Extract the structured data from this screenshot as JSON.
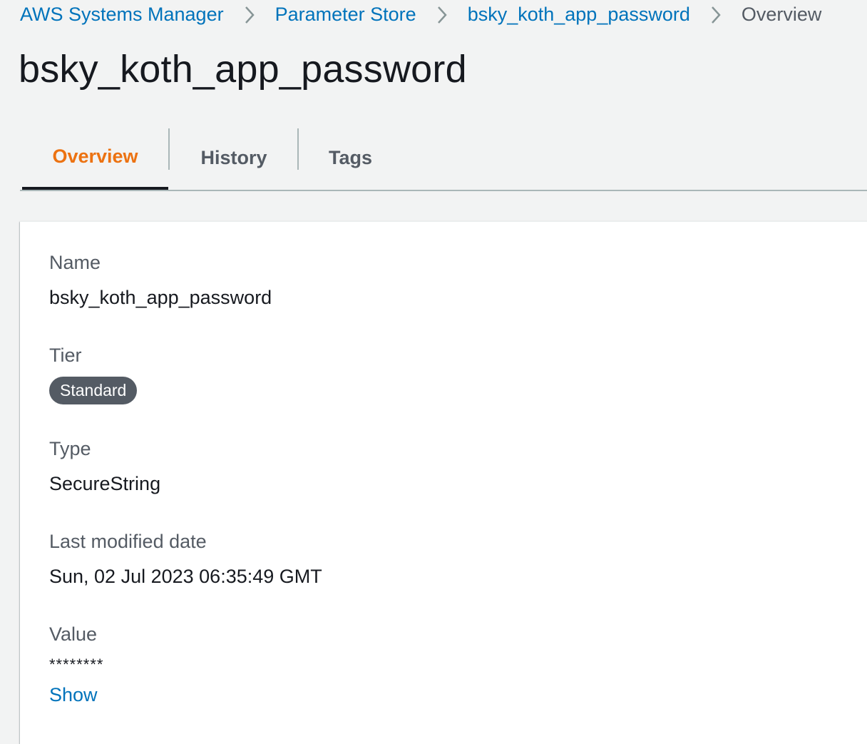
{
  "breadcrumb": {
    "items": [
      {
        "label": "AWS Systems Manager"
      },
      {
        "label": "Parameter Store"
      },
      {
        "label": "bsky_koth_app_password"
      },
      {
        "label": "Overview"
      }
    ]
  },
  "page": {
    "title": "bsky_koth_app_password"
  },
  "tabs": [
    {
      "label": "Overview",
      "active": true
    },
    {
      "label": "History",
      "active": false
    },
    {
      "label": "Tags",
      "active": false
    }
  ],
  "details": {
    "name": {
      "label": "Name",
      "value": "bsky_koth_app_password"
    },
    "tier": {
      "label": "Tier",
      "value": "Standard"
    },
    "type": {
      "label": "Type",
      "value": "SecureString"
    },
    "last_modified": {
      "label": "Last modified date",
      "value": "Sun, 02 Jul 2023 06:35:49 GMT"
    },
    "value": {
      "label": "Value",
      "masked": "********",
      "show_label": "Show"
    }
  },
  "colors": {
    "link": "#0073bb",
    "active_tab": "#ec7211",
    "badge_bg": "#545b64"
  },
  "icons": {
    "breadcrumb_separator": "chevron-right-icon"
  }
}
